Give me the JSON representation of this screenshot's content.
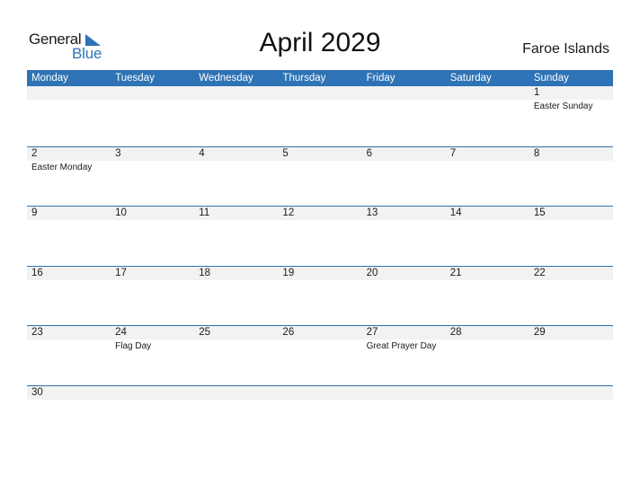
{
  "logo": {
    "line1": "General",
    "line2": "Blue",
    "icon": "triangle-flag-icon"
  },
  "header": {
    "title": "April 2029",
    "country": "Faroe Islands"
  },
  "colors": {
    "accent": "#2e73b5",
    "strip": "#f2f2f2"
  },
  "weekdays": [
    "Monday",
    "Tuesday",
    "Wednesday",
    "Thursday",
    "Friday",
    "Saturday",
    "Sunday"
  ],
  "weeks": [
    [
      {
        "n": ""
      },
      {
        "n": ""
      },
      {
        "n": ""
      },
      {
        "n": ""
      },
      {
        "n": ""
      },
      {
        "n": ""
      },
      {
        "n": "1",
        "h": "Easter Sunday"
      }
    ],
    [
      {
        "n": "2",
        "h": "Easter Monday"
      },
      {
        "n": "3"
      },
      {
        "n": "4"
      },
      {
        "n": "5"
      },
      {
        "n": "6"
      },
      {
        "n": "7"
      },
      {
        "n": "8"
      }
    ],
    [
      {
        "n": "9"
      },
      {
        "n": "10"
      },
      {
        "n": "11"
      },
      {
        "n": "12"
      },
      {
        "n": "13"
      },
      {
        "n": "14"
      },
      {
        "n": "15"
      }
    ],
    [
      {
        "n": "16"
      },
      {
        "n": "17"
      },
      {
        "n": "18"
      },
      {
        "n": "19"
      },
      {
        "n": "20"
      },
      {
        "n": "21"
      },
      {
        "n": "22"
      }
    ],
    [
      {
        "n": "23"
      },
      {
        "n": "24",
        "h": "Flag Day"
      },
      {
        "n": "25"
      },
      {
        "n": "26"
      },
      {
        "n": "27",
        "h": "Great Prayer Day"
      },
      {
        "n": "28"
      },
      {
        "n": "29"
      }
    ],
    [
      {
        "n": "30"
      },
      {
        "n": ""
      },
      {
        "n": ""
      },
      {
        "n": ""
      },
      {
        "n": ""
      },
      {
        "n": ""
      },
      {
        "n": ""
      }
    ]
  ]
}
